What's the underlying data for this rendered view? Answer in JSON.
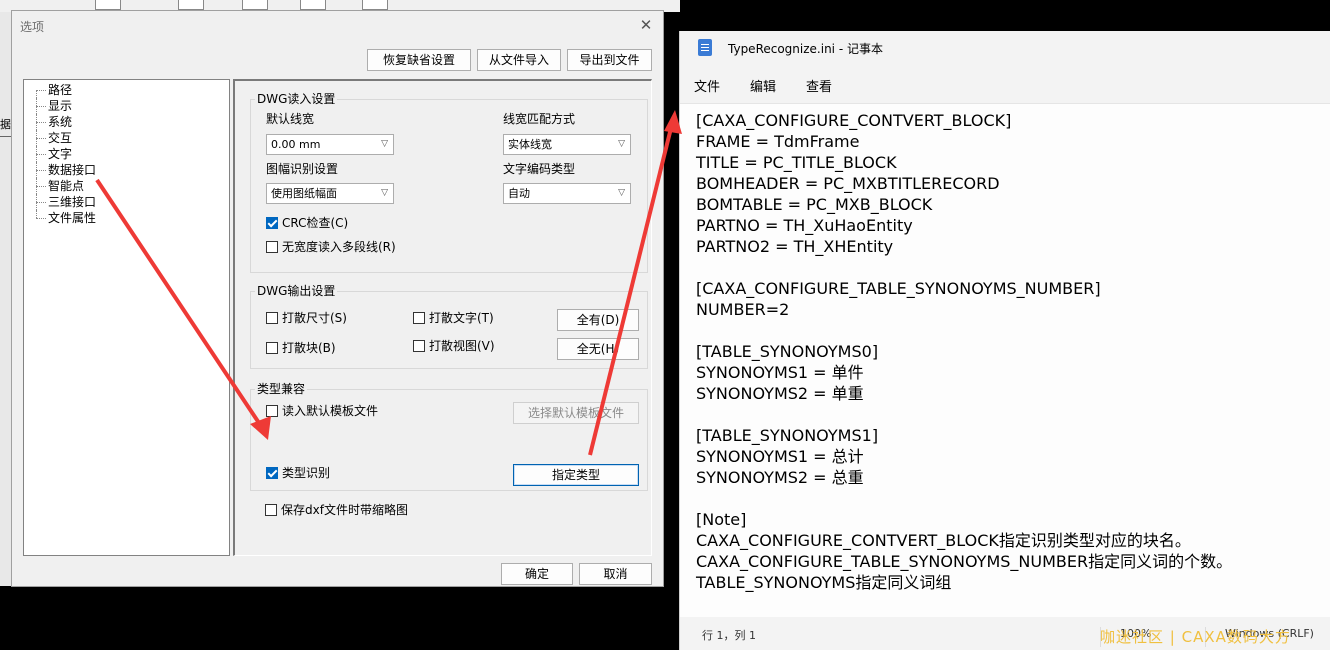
{
  "background": {
    "cut_text": "据"
  },
  "dialog": {
    "title": "选项",
    "close_glyph": "✕",
    "top_buttons": [
      "恢复缺省设置",
      "从文件导入",
      "导出到文件"
    ],
    "tree_items": [
      "路径",
      "显示",
      "系统",
      "交互",
      "文字",
      "数据接口",
      "智能点",
      "三维接口",
      "文件属性"
    ],
    "dwg_read": {
      "title": "DWG读入设置",
      "default_width_label": "默认线宽",
      "default_width_value": "0.00 mm",
      "width_match_label": "线宽匹配方式",
      "width_match_value": "实体线宽",
      "frame_detect_label": "图幅识别设置",
      "frame_detect_value": "使用图纸幅面",
      "text_encoding_label": "文字编码类型",
      "text_encoding_value": "自动",
      "crc_check": "CRC检查(C)",
      "no_width_polyline": "无宽度读入多段线(R)"
    },
    "dwg_out": {
      "title": "DWG输出设置",
      "explode_dim": "打散尺寸(S)",
      "explode_text": "打散文字(T)",
      "explode_block": "打散块(B)",
      "explode_view": "打散视图(V)",
      "select_all": "全有(D)",
      "select_none": "全无(H)"
    },
    "type_compat": {
      "title": "类型兼容",
      "read_template": "读入默认模板文件",
      "choose_template": "选择默认模板文件",
      "type_recognition": "类型识别",
      "assign_type": "指定类型"
    },
    "save_dxf_thumb": "保存dxf文件时带缩略图",
    "ok": "确定",
    "cancel": "取消"
  },
  "notepad": {
    "title": "TypeRecognize.ini - 记事本",
    "menu": [
      "文件",
      "编辑",
      "查看"
    ],
    "lines": [
      "[CAXA_CONFIGURE_CONTVERT_BLOCK]",
      "FRAME = TdmFrame",
      "TITLE = PC_TITLE_BLOCK",
      "BOMHEADER = PC_MXBTITLERECORD",
      "BOMTABLE = PC_MXB_BLOCK",
      "PARTNO = TH_XuHaoEntity",
      "PARTNO2 = TH_XHEntity",
      "",
      "[CAXA_CONFIGURE_TABLE_SYNONOYMS_NUMBER]",
      "NUMBER=2",
      "",
      "[TABLE_SYNONOYMS0]",
      "SYNONOYMS1 = 单件",
      "SYNONOYMS2 = 单重",
      "",
      "[TABLE_SYNONOYMS1]",
      "SYNONOYMS1 = 总计",
      "SYNONOYMS2 = 总重",
      "",
      "[Note]",
      "CAXA_CONFIGURE_CONTVERT_BLOCK指定识别类型对应的块名。",
      "CAXA_CONFIGURE_TABLE_SYNONOYMS_NUMBER指定同义词的个数。",
      "TABLE_SYNONOYMS指定同义词组"
    ],
    "status": {
      "position": "行 1，列 1",
      "zoom": "100%",
      "line_ending": "Windows (CRLF)"
    }
  },
  "watermark": "咖迷社区 | CAXA数码大方",
  "colors": {
    "arrow": "#ee3a36",
    "check_accent": "#0067c0"
  }
}
